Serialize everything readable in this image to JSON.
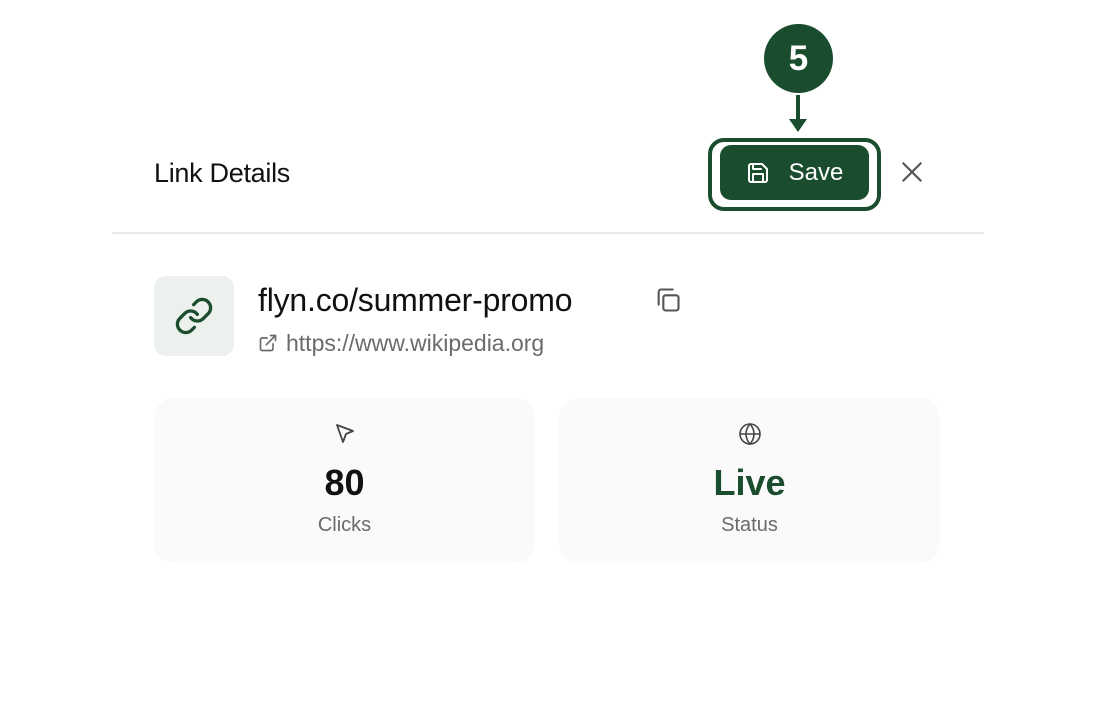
{
  "header": {
    "title": "Link Details",
    "save_label": "Save"
  },
  "step_marker": {
    "number": "5"
  },
  "link": {
    "short_url": "flyn.co/summer-promo",
    "destination_url": "https://www.wikipedia.org"
  },
  "stats": {
    "clicks": {
      "value": "80",
      "label": "Clicks",
      "icon": "cursor-pointer-icon"
    },
    "status": {
      "value": "Live",
      "label": "Status",
      "icon": "globe-icon"
    }
  },
  "colors": {
    "accent": "#1a4d2e",
    "muted_text": "#6b6b6b",
    "tile_bg": "#edf1ee",
    "card_bg": "#fafafa",
    "divider": "#e8e8e8"
  },
  "icons": {
    "save": "floppy-disk-icon",
    "close": "close-icon",
    "link": "link-chain-icon",
    "copy": "copy-icon",
    "external": "external-link-icon"
  }
}
